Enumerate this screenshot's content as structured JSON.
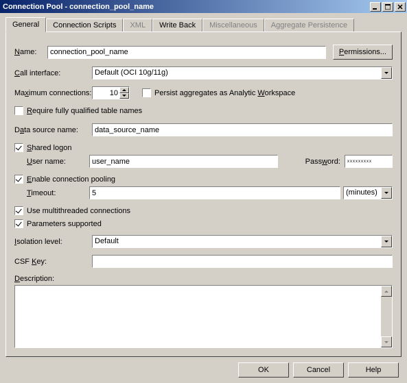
{
  "window": {
    "title": "Connection Pool -  connection_pool_name"
  },
  "tabs": [
    "General",
    "Connection Scripts",
    "XML",
    "Write Back",
    "Miscellaneous",
    "Aggregate Persistence"
  ],
  "labels": {
    "name": "Name:",
    "permissions": "Permissions...",
    "call_interface": "Call interface:",
    "max_conn": "Maximum connections:",
    "persist_agg": "Persist aggregates as Analytic Workspace",
    "require_fq": "Require fully qualified table names",
    "data_source": "Data source name:",
    "shared_logon": "Shared logon",
    "user_name": "User name:",
    "password": "Password:",
    "enable_pool": "Enable connection pooling",
    "timeout": "Timeout:",
    "timeout_unit": "(minutes)",
    "multithread": "Use multithreaded connections",
    "params_supported": "Parameters supported",
    "isolation": "Isolation level:",
    "csf_key": "CSF Key:",
    "description": "Description:"
  },
  "values": {
    "name": "connection_pool_name",
    "call_interface": "Default (OCI 10g/11g)",
    "max_conn": "10",
    "data_source": "data_source_name",
    "user_name": "user_name",
    "password": "xxxxxxxxx",
    "timeout": "5",
    "isolation": "Default",
    "csf_key": "",
    "description": ""
  },
  "buttons": {
    "ok": "OK",
    "cancel": "Cancel",
    "help": "Help"
  }
}
